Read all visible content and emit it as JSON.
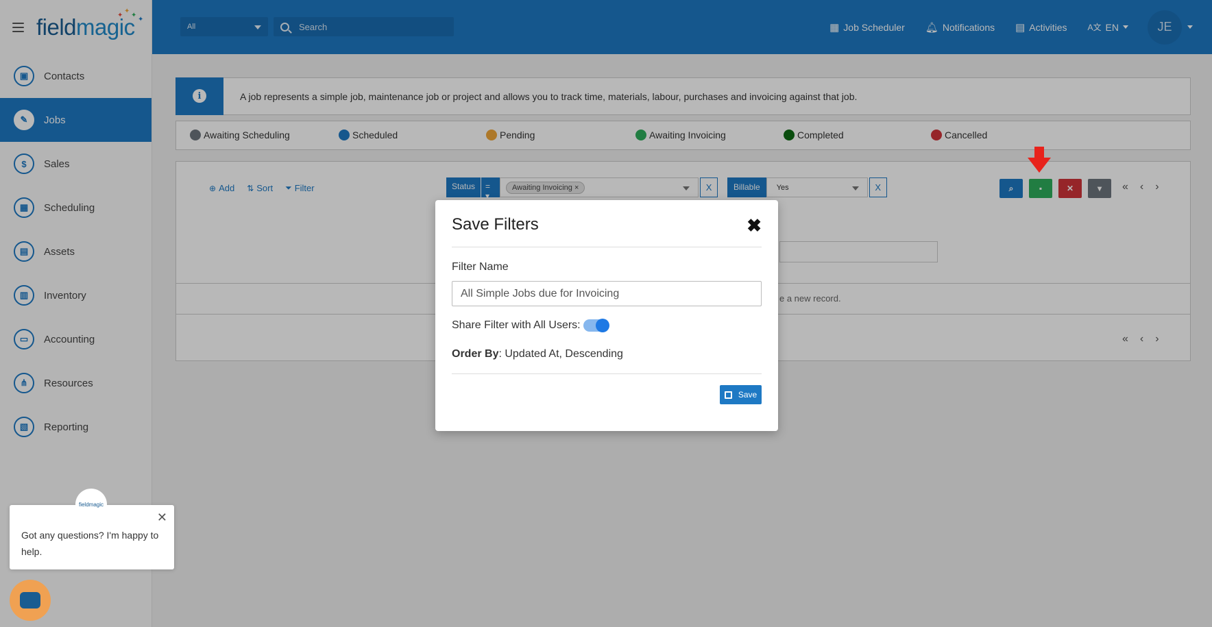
{
  "sidebar": {
    "logo_field": "field",
    "logo_magic": "magic",
    "items": [
      {
        "label": "Contacts",
        "icon": "contacts-icon",
        "glyph": "▣"
      },
      {
        "label": "Jobs",
        "icon": "wrench-icon",
        "glyph": "✎",
        "active": true
      },
      {
        "label": "Sales",
        "icon": "dollar-icon",
        "glyph": "$"
      },
      {
        "label": "Scheduling",
        "icon": "calendar-icon",
        "glyph": "▦"
      },
      {
        "label": "Assets",
        "icon": "briefcase-icon",
        "glyph": "▤"
      },
      {
        "label": "Inventory",
        "icon": "warehouse-icon",
        "glyph": "▥"
      },
      {
        "label": "Accounting",
        "icon": "wallet-icon",
        "glyph": "▭"
      },
      {
        "label": "Resources",
        "icon": "network-icon",
        "glyph": "⋔"
      },
      {
        "label": "Reporting",
        "icon": "report-icon",
        "glyph": "▧"
      }
    ]
  },
  "topbar": {
    "scope_value": "All",
    "search_placeholder": "Search",
    "job_scheduler": "Job Scheduler",
    "notifications": "Notifications",
    "activities": "Activities",
    "language": "EN",
    "avatar_initials": "JE"
  },
  "info": {
    "text": "A job represents a simple job, maintenance job or project and allows you to track time, materials, labour, purchases and invoicing against that job."
  },
  "legend": [
    {
      "label": "Awaiting Scheduling",
      "color": "#6c757d"
    },
    {
      "label": "Scheduled",
      "color": "#1e79c4"
    },
    {
      "label": "Pending",
      "color": "#f0a73a"
    },
    {
      "label": "Awaiting Invoicing",
      "color": "#2fae5c"
    },
    {
      "label": "Completed",
      "color": "#0f6b14"
    },
    {
      "label": "Cancelled",
      "color": "#d0343a"
    }
  ],
  "toolbar": {
    "add": "Add",
    "sort": "Sort",
    "filter": "Filter",
    "status_label": "Status",
    "status_op": "=",
    "status_tag": "Awaiting Invoicing",
    "clear_x": "X",
    "billable_label": "Billable",
    "billable_value": "Yes"
  },
  "empty_message": "e a new record.",
  "modal": {
    "title": "Save Filters",
    "close": "✖",
    "filter_name_label": "Filter Name",
    "filter_name_value": "All Simple Jobs due for Invoicing",
    "share_label": "Share Filter with All Users:",
    "share_enabled": true,
    "order_by_label": "Order By",
    "order_by_value": ": Updated At, Descending",
    "save_label": "Save"
  },
  "chat": {
    "message": "Got any questions? I'm happy to help.",
    "avatar_text": "fieldmagic"
  },
  "colors": {
    "primary": "#1e79c4",
    "success": "#2fae5c",
    "danger": "#d0343a",
    "secondary": "#6c757d",
    "arrow": "#e8231c"
  }
}
